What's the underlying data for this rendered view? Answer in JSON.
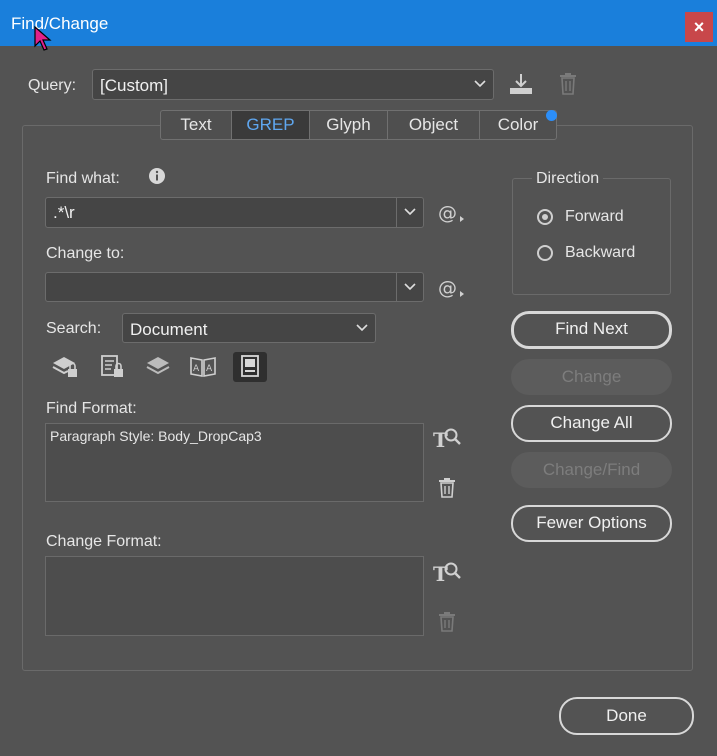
{
  "window": {
    "title": "Find/Change",
    "close_label": "×"
  },
  "query": {
    "label": "Query:",
    "value": "[Custom]"
  },
  "tabs": [
    {
      "label": "Text",
      "active": false
    },
    {
      "label": "GREP",
      "active": true
    },
    {
      "label": "Glyph",
      "active": false
    },
    {
      "label": "Object",
      "active": false
    },
    {
      "label": "Color",
      "active": false
    }
  ],
  "find_what": {
    "label": "Find what:",
    "value": ".*\\r"
  },
  "change_to": {
    "label": "Change to:",
    "value": ""
  },
  "search": {
    "label": "Search:",
    "value": "Document"
  },
  "find_format": {
    "label": "Find Format:",
    "value": "Paragraph Style: Body_DropCap3"
  },
  "change_format": {
    "label": "Change Format:",
    "value": ""
  },
  "direction": {
    "label": "Direction",
    "forward": "Forward",
    "backward": "Backward",
    "selected": "Forward"
  },
  "buttons": {
    "find_next": "Find Next",
    "change": "Change",
    "change_all": "Change All",
    "change_find": "Change/Find",
    "fewer_options": "Fewer Options",
    "done": "Done"
  },
  "colors": {
    "titlebar": "#1a7fdb",
    "background": "#535353",
    "active_tab": "#5fa7f0",
    "close": "#c8474a"
  },
  "icons": [
    "info-icon",
    "save-query-icon",
    "delete-query-icon",
    "special-characters-icon",
    "include-locked-layers-icon",
    "include-locked-stories-icon",
    "include-hidden-layers-icon",
    "include-master-pages-icon",
    "include-footnotes-icon",
    "specify-format-icon",
    "clear-format-icon"
  ]
}
